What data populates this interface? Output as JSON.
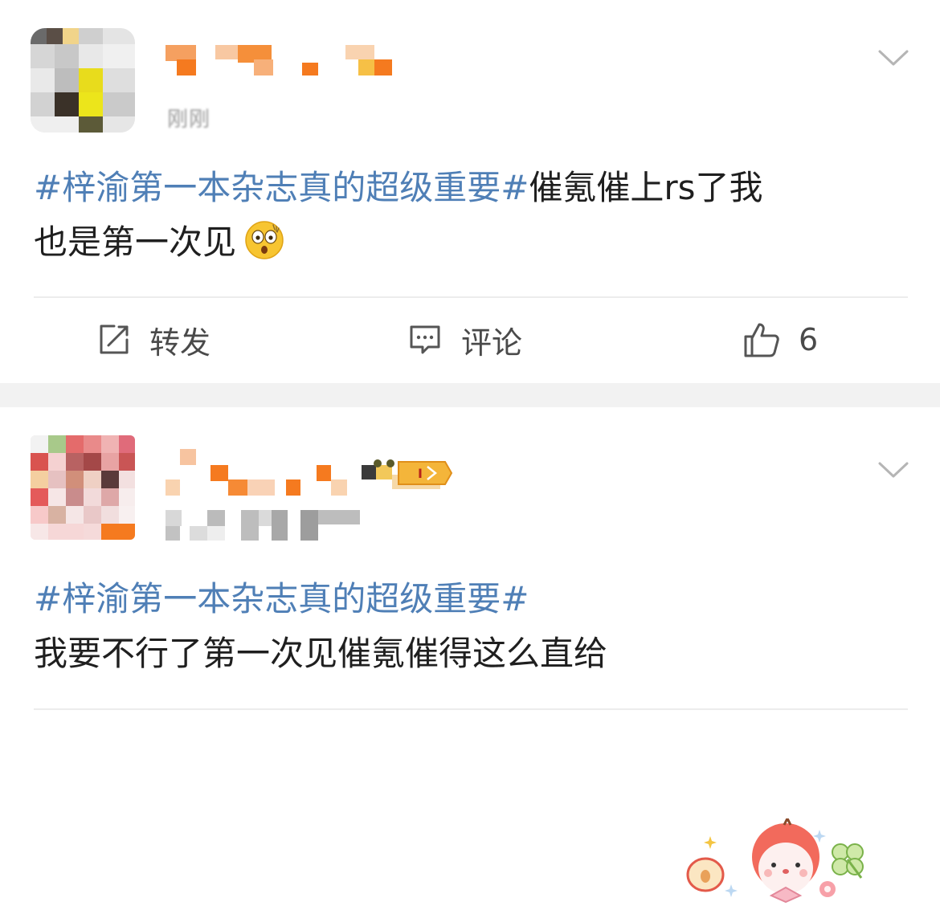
{
  "posts": [
    {
      "timestamp": "刚刚",
      "hashtag": "#梓渝第一本杂志真的超级重要#",
      "text_after_tag": "催氪催上rs了我",
      "text_line2": "也是第一次见",
      "emoji": "astonished-face-emoji",
      "actions": {
        "repost_label": "转发",
        "comment_label": "评论",
        "like_count": "6"
      }
    },
    {
      "hashtag": "#梓渝第一本杂志真的超级重要#",
      "text": "我要不行了第一次见催氪催得这么直给",
      "sticker": "apple-bunny-sticker"
    }
  ],
  "icons": {
    "chevron": "chevron-down-icon",
    "repost": "repost-icon",
    "comment": "comment-icon",
    "like": "thumbs-up-icon"
  },
  "colors": {
    "hashtag": "#4f7fb6",
    "text": "#1f1f1f",
    "action_gray": "#4a4a4a",
    "separator": "#f2f2f2",
    "blur_orange": "#f57a1f"
  }
}
